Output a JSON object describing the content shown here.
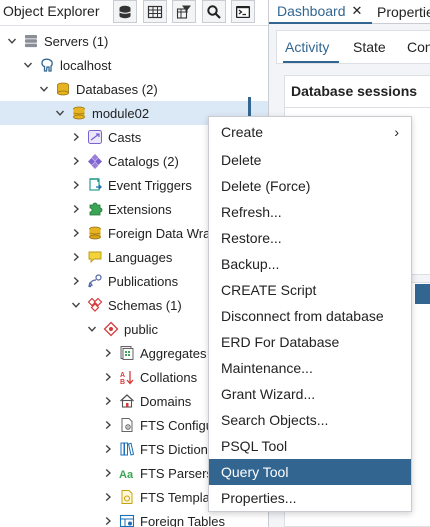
{
  "object_explorer": {
    "title": "Object Explorer",
    "toolbar": [
      "database-icon",
      "table-icon",
      "filter-table-icon",
      "search-icon",
      "terminal-icon"
    ]
  },
  "tree": {
    "items": [
      {
        "label": "Servers (1)",
        "icon": "servers-icon"
      },
      {
        "label": "localhost",
        "icon": "postgres-elephant-icon"
      },
      {
        "label": "Databases (2)",
        "icon": "databases-icon"
      },
      {
        "label": "module02",
        "icon": "database-icon"
      },
      {
        "label": "Casts",
        "icon": "casts-icon"
      },
      {
        "label": "Catalogs (2)",
        "icon": "catalogs-icon"
      },
      {
        "label": "Event Triggers",
        "icon": "event-triggers-icon"
      },
      {
        "label": "Extensions",
        "icon": "extensions-icon"
      },
      {
        "label": "Foreign Data Wra",
        "icon": "foreign-data-wrapper-icon"
      },
      {
        "label": "Languages",
        "icon": "languages-icon"
      },
      {
        "label": "Publications",
        "icon": "publications-icon"
      },
      {
        "label": "Schemas (1)",
        "icon": "schemas-icon"
      },
      {
        "label": "public",
        "icon": "schema-icon"
      },
      {
        "label": "Aggregates",
        "icon": "aggregates-icon"
      },
      {
        "label": "Collations",
        "icon": "collations-icon"
      },
      {
        "label": "Domains",
        "icon": "domains-icon"
      },
      {
        "label": "FTS Configu",
        "icon": "fts-config-icon"
      },
      {
        "label": "FTS Diction",
        "icon": "fts-dictionary-icon"
      },
      {
        "label": "FTS Parsers",
        "icon": "fts-parser-icon"
      },
      {
        "label": "FTS Templa",
        "icon": "fts-template-icon"
      },
      {
        "label": "Foreign Tables",
        "icon": "foreign-tables-icon"
      }
    ]
  },
  "tabs": {
    "dashboard": "Dashboard",
    "close": "✕",
    "properties": "Propertie"
  },
  "subtabs": {
    "activity": "Activity",
    "state": "State",
    "config": "Con"
  },
  "dashboard": {
    "sessions_title": "Database sessions"
  },
  "context_menu": {
    "items": [
      {
        "label": "Create",
        "submenu": "›"
      },
      {
        "label": "Delete"
      },
      {
        "label": "Delete (Force)"
      },
      {
        "label": "Refresh..."
      },
      {
        "label": "Restore..."
      },
      {
        "label": "Backup..."
      },
      {
        "label": "CREATE Script"
      },
      {
        "label": "Disconnect from database"
      },
      {
        "label": "ERD For Database"
      },
      {
        "label": "Maintenance..."
      },
      {
        "label": "Grant Wizard..."
      },
      {
        "label": "Search Objects..."
      },
      {
        "label": "PSQL Tool"
      },
      {
        "label": "Query Tool"
      },
      {
        "label": "Properties..."
      }
    ],
    "highlighted": "Query Tool"
  },
  "colors": {
    "accent": "#326690",
    "selection": "#dbe8f6"
  }
}
